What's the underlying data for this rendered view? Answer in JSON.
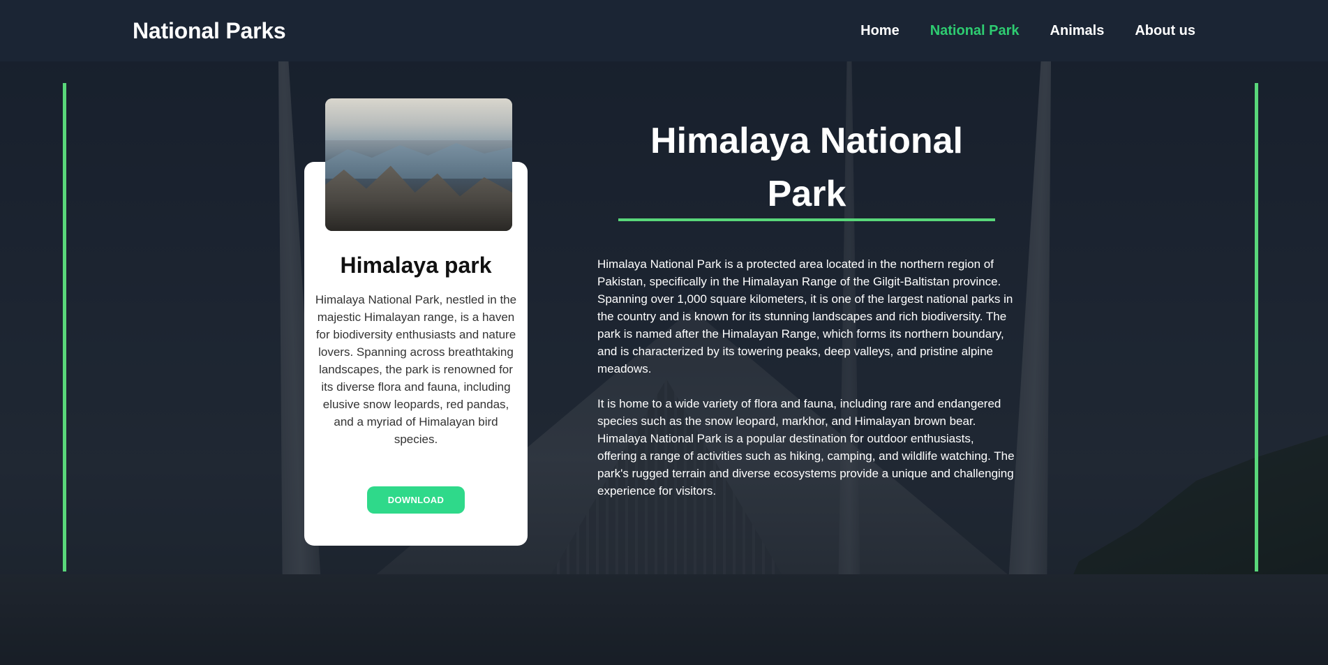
{
  "header": {
    "brand": "National Parks",
    "nav": [
      {
        "label": "Home",
        "active": false
      },
      {
        "label": "National Park",
        "active": true
      },
      {
        "label": "Animals",
        "active": false
      },
      {
        "label": "About us",
        "active": false
      }
    ]
  },
  "card": {
    "image_name": "himalaya-mountains-image",
    "title": "Himalaya park",
    "text": "Himalaya National Park, nestled in the majestic Himalayan range, is a haven for biodiversity enthusiasts and nature lovers. Spanning across breathtaking landscapes, the park is renowned for its diverse flora and fauna, including elusive snow leopards, red pandas, and a myriad of Himalayan bird species.",
    "button_label": "DOWNLOAD"
  },
  "main": {
    "title": "Himalaya National Park",
    "paragraphs": [
      "Himalaya National Park is a protected area located in the northern region of Pakistan, specifically in the Himalayan Range of the Gilgit-Baltistan province. Spanning over 1,000 square kilometers, it is one of the largest national parks in the country and is known for its stunning landscapes and rich biodiversity. The park is named after the Himalayan Range, which forms its northern boundary, and is characterized by its towering peaks, deep valleys, and pristine alpine meadows.",
      "It is home to a wide variety of flora and fauna, including rare and endangered species such as the snow leopard, markhor, and Himalayan brown bear. Himalaya National Park is a popular destination for outdoor enthusiasts, offering a range of activities such as hiking, camping, and wildlife watching. The park's rugged terrain and diverse ecosystems provide a unique and challenging experience for visitors."
    ]
  },
  "colors": {
    "accent": "#2ecc71",
    "accent_bar": "#59d77a",
    "button": "#2fd98a",
    "navbar": "#1b2534"
  }
}
